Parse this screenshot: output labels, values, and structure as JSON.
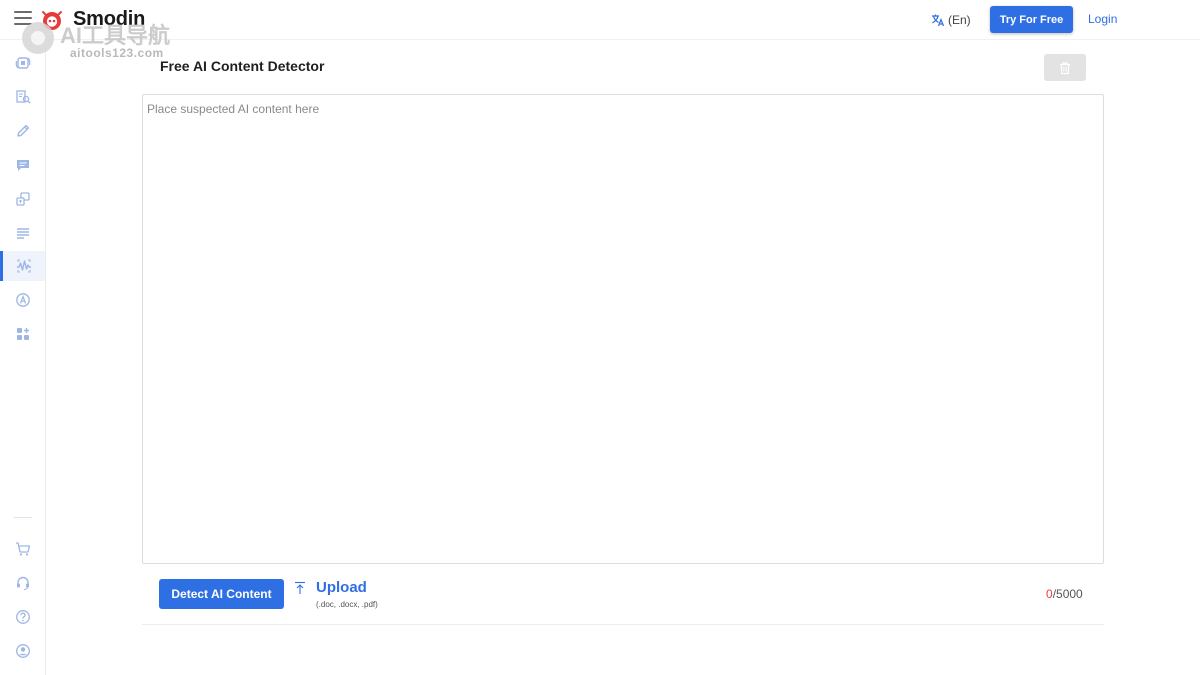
{
  "header": {
    "brand": "Smodin",
    "language": "(En)",
    "try_button": "Try For Free",
    "login": "Login"
  },
  "watermark": {
    "title": "AI工具导航",
    "subtitle": "aitools123.com"
  },
  "sidebar": {
    "items": [
      {
        "icon": "rewriter-icon"
      },
      {
        "icon": "plagiarism-icon"
      },
      {
        "icon": "pen-icon"
      },
      {
        "icon": "chat-icon"
      },
      {
        "icon": "translate-icon"
      },
      {
        "icon": "summarizer-icon"
      },
      {
        "icon": "ai-detector-icon",
        "active": true
      },
      {
        "icon": "ai-grader-icon"
      },
      {
        "icon": "apps-icon"
      }
    ],
    "bottom_items": [
      {
        "icon": "cart-icon"
      },
      {
        "icon": "support-icon"
      },
      {
        "icon": "help-icon"
      },
      {
        "icon": "account-icon"
      }
    ]
  },
  "main": {
    "title": "Free AI Content Detector",
    "editor_placeholder": "Place suspected AI content here",
    "detect_button": "Detect AI Content",
    "upload_label": "Upload",
    "upload_hint": "(.doc, .docx, .pdf)",
    "char_count": "0",
    "char_limit": "/5000"
  },
  "colors": {
    "accent": "#2f6fe4",
    "counter_zero": "#e04040",
    "sidebar_icon": "#9db6e6"
  }
}
